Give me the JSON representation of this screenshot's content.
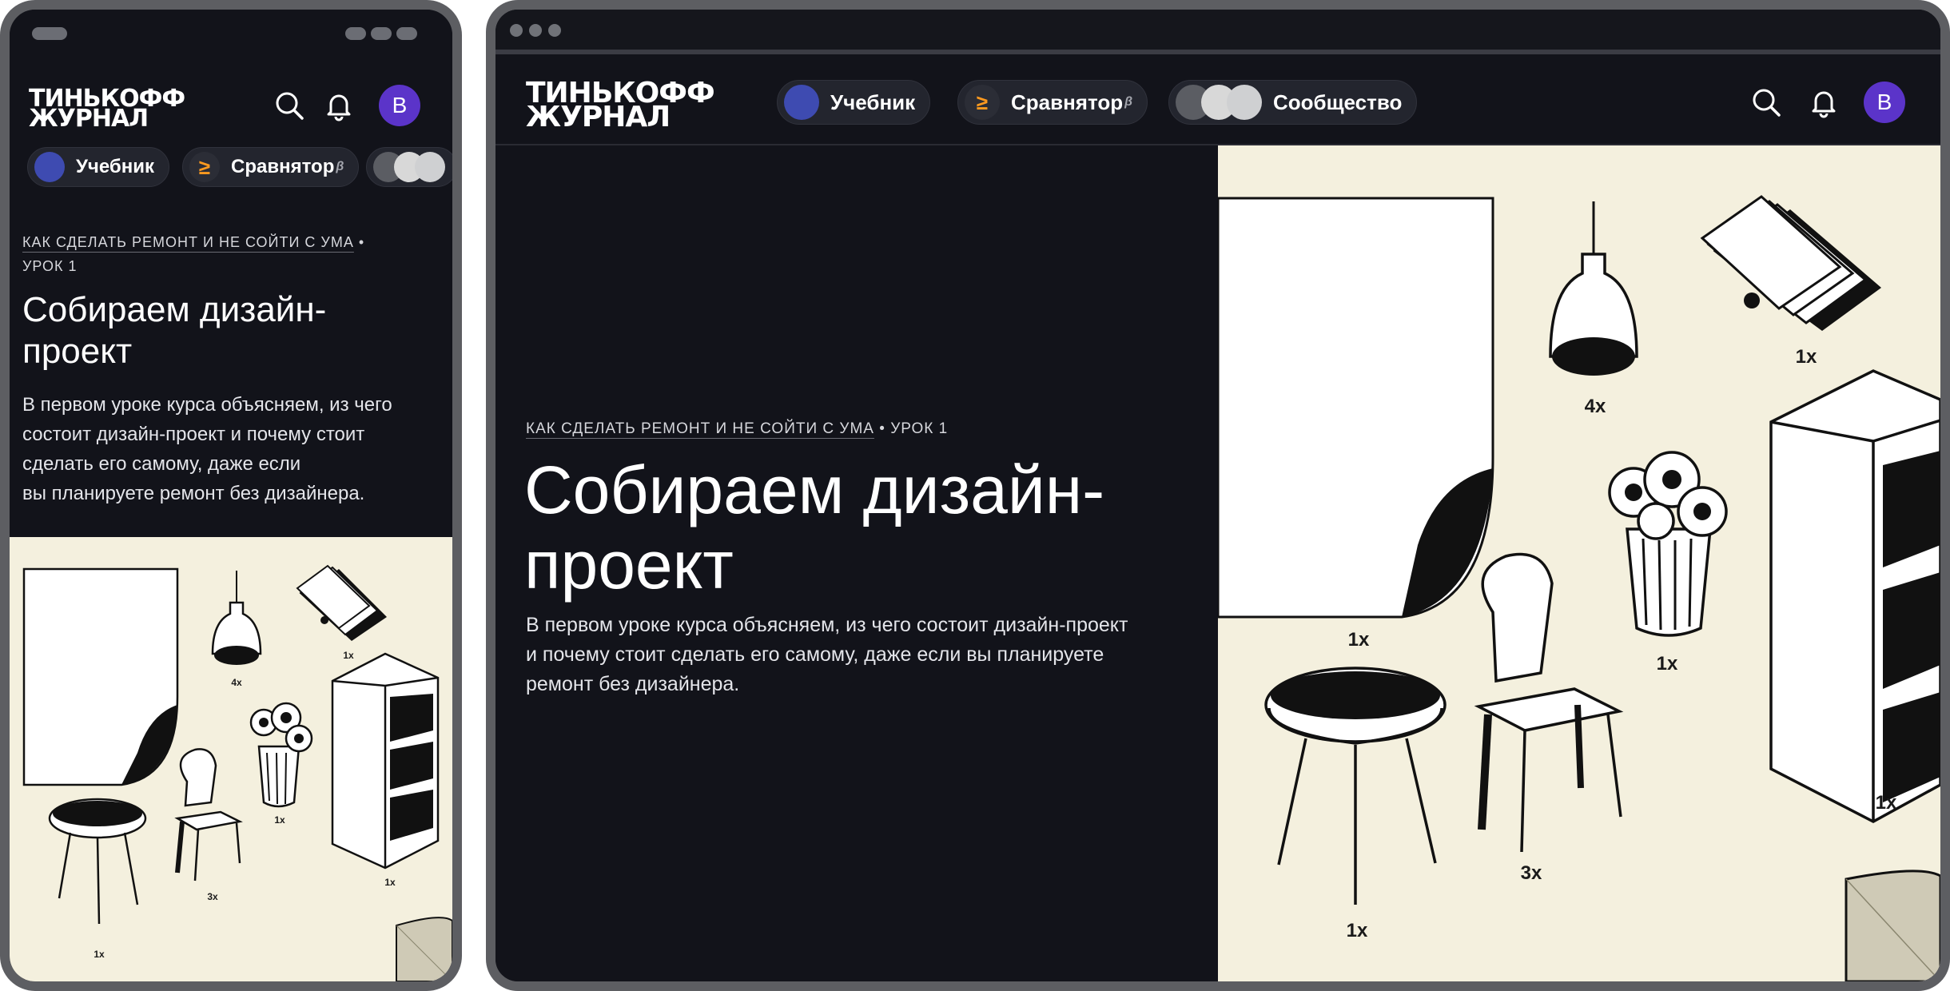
{
  "logo": {
    "line1": "ТИНЬКОФФ",
    "line2": "ЖУРНАЛ"
  },
  "nav": {
    "textbook": "Учебник",
    "comparator": "Сравнятор",
    "comparator_badge": "β",
    "community": "Сообщество",
    "comparator_icon": "≥"
  },
  "user": {
    "initial": "В"
  },
  "icons": {
    "search": "search-icon",
    "bell": "bell-icon"
  },
  "article": {
    "course_link": "КАК СДЕЛАТЬ РЕМОНТ И НЕ СОЙТИ С УМА",
    "separator": "•",
    "lesson": "УРОК 1",
    "title_line1": "Собираем дизайн-",
    "title_line2": "проект",
    "lead_line1": "В первом уроке курса объясняем, из чего состоит дизайн-проект",
    "lead_line2": "и почему стоит сделать его самому, даже если вы планируете",
    "lead_line3": "ремонт без дизайнера.",
    "lead_mobile_line1": "В первом уроке курса объясняем, из чего",
    "lead_mobile_line2": "состоит дизайн-проект и почему стоит",
    "lead_mobile_line3": "сделать его самому, даже если",
    "lead_mobile_line4": "вы планируете ремонт без дизайнера."
  },
  "illustration": {
    "paper_qty": "1x",
    "lamp_qty": "4x",
    "swatches_qty": "1x",
    "plant_qty": "1x",
    "shelf_qty": "1x",
    "chair_qty": "3x",
    "table_qty": "1x"
  },
  "colors": {
    "page_bg": "#12131a",
    "illustration_bg": "#f4f0de",
    "avatar": "#5b34c9",
    "comparator_accent": "#ff9a1f"
  }
}
